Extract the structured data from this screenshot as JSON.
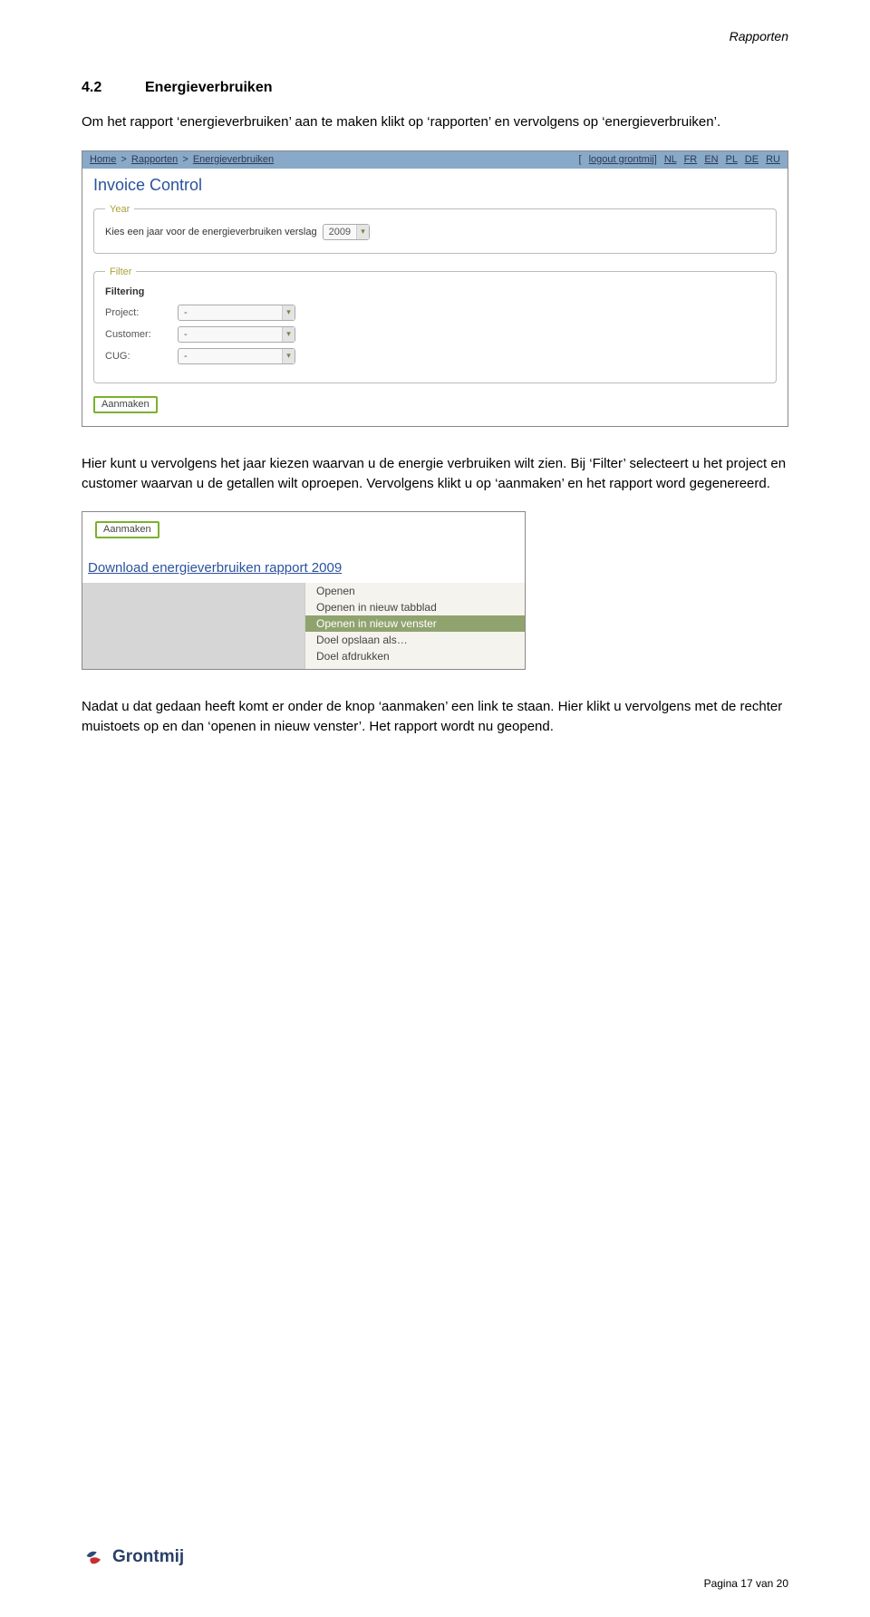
{
  "header": {
    "section_label": "Rapporten"
  },
  "section": {
    "number": "4.2",
    "title": "Energieverbruiken"
  },
  "paragraphs": {
    "p1": "Om het rapport ‘energieverbruiken’ aan te maken klikt op ‘rapporten’ en vervolgens op ‘energieverbruiken’.",
    "p2": "Hier kunt u vervolgens het jaar kiezen waarvan u de energie verbruiken wilt zien. Bij ‘Filter’ selecteert u het project en customer waarvan u de getallen wilt oproepen. Vervolgens klikt u op ‘aanmaken’ en het rapport word gegenereerd.",
    "p3": "Nadat u dat gedaan heeft komt er onder de knop ‘aanmaken’ een link te staan. Hier klikt u vervolgens met de rechter muistoets op en dan ‘openen in nieuw venster’. Het rapport wordt nu geopend."
  },
  "shot1": {
    "crumbs": {
      "home": "Home",
      "rapporten": "Rapporten",
      "page": "Energieverbruiken",
      "sep": ">"
    },
    "top_right": {
      "logout_bracket_open": "[",
      "logout": "logout grontmij",
      "logout_bracket_close": "]",
      "langs": [
        "NL",
        "FR",
        "EN",
        "PL",
        "DE",
        "RU"
      ]
    },
    "title": "Invoice Control",
    "year_panel": {
      "legend": "Year",
      "label": "Kies een jaar voor de energieverbruiken verslag",
      "value": "2009"
    },
    "filter_panel": {
      "legend": "Filter",
      "filtering": "Filtering",
      "rows": {
        "project_label": "Project:",
        "project_value": "-",
        "customer_label": "Customer:",
        "customer_value": "-",
        "cug_label": "CUG:",
        "cug_value": "-"
      }
    },
    "button": "Aanmaken"
  },
  "shot2": {
    "button": "Aanmaken",
    "download_title": "Download energieverbruiken rapport 2009",
    "context_menu": {
      "items": [
        "Openen",
        "Openen in nieuw tabblad",
        "Openen in nieuw venster",
        "Doel opslaan als…",
        "Doel afdrukken"
      ],
      "selected_index": 2
    }
  },
  "footer": {
    "brand": "Grontmij",
    "page": "Pagina 17 van 20"
  }
}
